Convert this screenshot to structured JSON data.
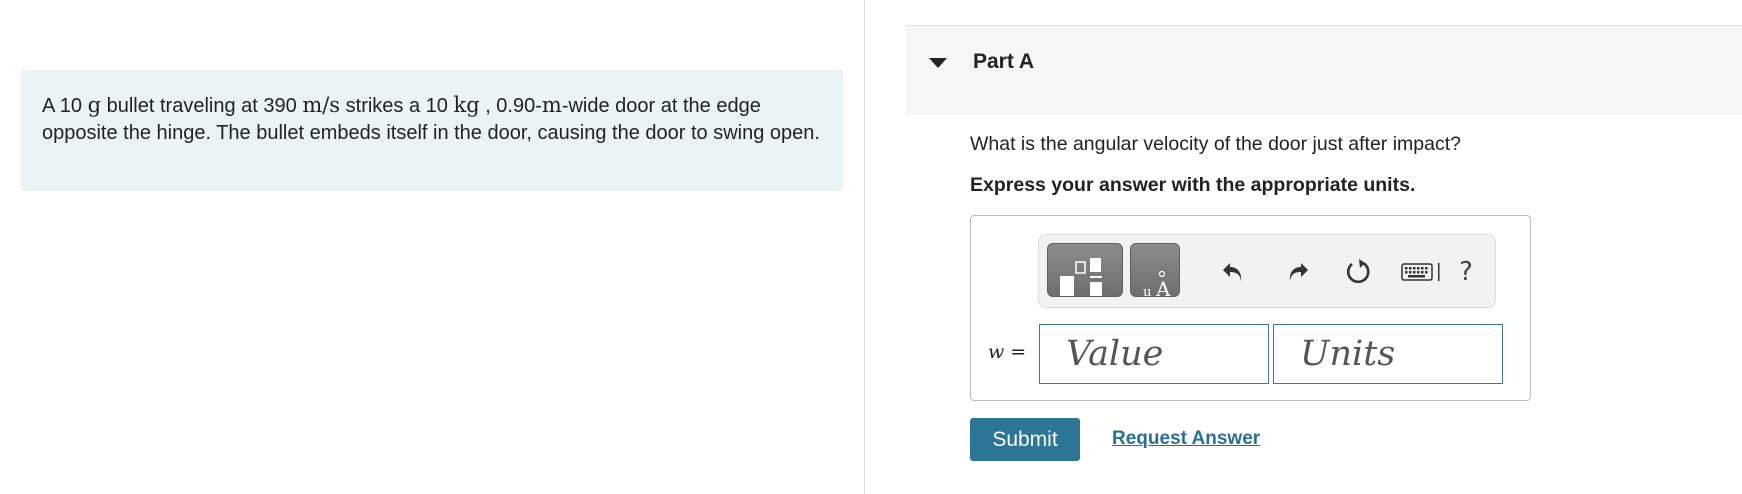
{
  "problem": {
    "p1": "A 10 ",
    "m1": "g",
    "p2": " bullet traveling at 390 ",
    "m2": "m/s",
    "p3": " strikes a 10 ",
    "m3": "kg",
    "p4": " , 0.90-",
    "m4": "m",
    "p5": "-wide door at the edge opposite the hinge. The bullet embeds itself in the door, causing the door to swing open."
  },
  "part": {
    "title": "Part A"
  },
  "question": "What is the angular velocity of the door just after impact?",
  "instruction": "Express your answer with the appropriate units.",
  "toolbar": {
    "icons": [
      "templates-icon",
      "units-icon",
      "undo-icon",
      "redo-icon",
      "reset-icon",
      "keyboard-icon",
      "help-icon"
    ],
    "help_label": "?"
  },
  "answer": {
    "variable": "w =",
    "value_placeholder": "Value",
    "units_placeholder": "Units"
  },
  "actions": {
    "submit": "Submit",
    "request": "Request Answer"
  },
  "colors": {
    "accent": "#2d7595",
    "link": "#2a6f95",
    "problem_bg": "#eaf4f7"
  }
}
